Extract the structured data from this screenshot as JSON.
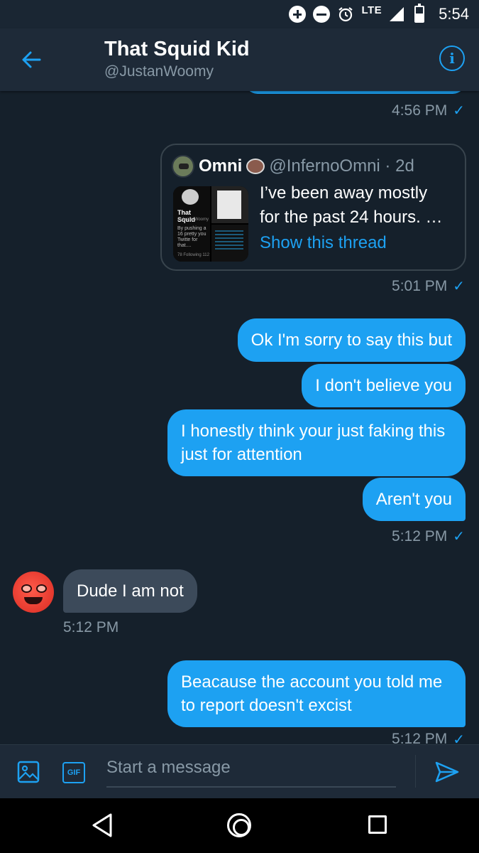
{
  "status_bar": {
    "network": "LTE",
    "time": "5:54"
  },
  "header": {
    "title": "That Squid Kid",
    "handle": "@JustanWoomy"
  },
  "messages": [
    {
      "type": "timestamp",
      "text": "4:56 PM",
      "check": "✓"
    },
    {
      "type": "tweet_card",
      "author_name": "Omni",
      "author_handle": "@InfernoOmni · 2d",
      "text_line1": "I’ve been away mostly",
      "text_line2": "for the past 24 hours. …",
      "link": "Show this thread",
      "thumb_name": "That Squid",
      "thumb_handle": "@JustanWoomy",
      "thumb_bio": "By pushing a 16 pretty you Twitte for that....",
      "thumb_following": "78 Following  112",
      "timestamp": "5:01 PM"
    },
    {
      "type": "outgoing",
      "text": "Ok I'm sorry to say this but"
    },
    {
      "type": "outgoing",
      "text": "I don't believe you"
    },
    {
      "type": "outgoing",
      "text": "I honestly think your just faking this just for attention"
    },
    {
      "type": "outgoing",
      "text": "Aren't you"
    },
    {
      "type": "timestamp",
      "text": "5:12 PM",
      "check": "✓"
    },
    {
      "type": "incoming",
      "text": "Dude I am not",
      "timestamp": "5:12 PM"
    },
    {
      "type": "outgoing",
      "text": "Beacause the account you told me to report doesn't excist"
    },
    {
      "type": "timestamp",
      "text": "5:12 PM",
      "check": "✓"
    }
  ],
  "composer": {
    "placeholder": "Start a message",
    "gif_label": "GIF"
  },
  "colors": {
    "background": "#15202b",
    "accent": "#1da1f2",
    "muted": "#8899a6",
    "incoming_bubble": "#3c4a5a"
  }
}
